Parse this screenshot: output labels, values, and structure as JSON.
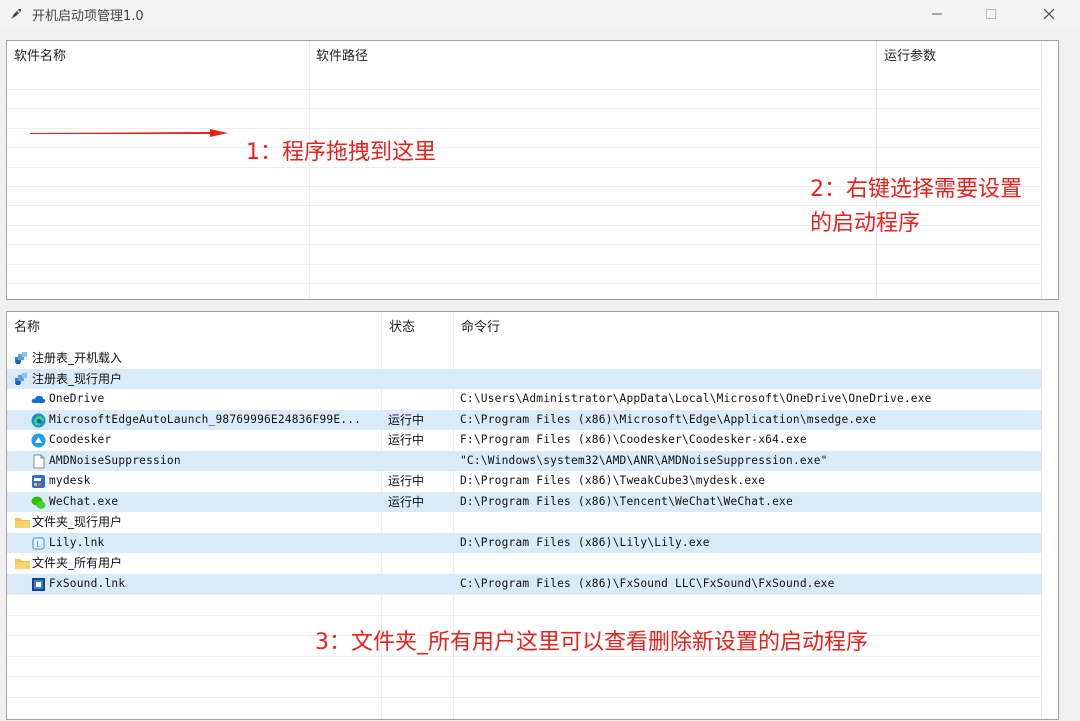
{
  "window": {
    "title": "开机启动项管理1.0"
  },
  "top_table": {
    "columns": [
      "软件名称",
      "软件路径",
      "运行参数"
    ]
  },
  "bottom_table": {
    "columns": [
      "名称",
      "状态",
      "命令行"
    ],
    "rows": [
      {
        "name": "注册表_开机载入",
        "status": "",
        "cmd": "",
        "icon": "registry-icon",
        "indent": 0,
        "selected": false
      },
      {
        "name": "注册表_现行用户",
        "status": "",
        "cmd": "",
        "icon": "registry-icon",
        "indent": 0,
        "selected": true
      },
      {
        "name": "OneDrive",
        "status": "",
        "cmd": "C:\\Users\\Administrator\\AppData\\Local\\Microsoft\\OneDrive\\OneDrive.exe",
        "icon": "onedrive-icon",
        "indent": 1,
        "selected": false
      },
      {
        "name": "MicrosoftEdgeAutoLaunch_98769996E24836F99E...",
        "status": "运行中",
        "cmd": "C:\\Program Files (x86)\\Microsoft\\Edge\\Application\\msedge.exe",
        "icon": "edge-icon",
        "indent": 1,
        "selected": true
      },
      {
        "name": "Coodesker",
        "status": "运行中",
        "cmd": "F:\\Program Files (x86)\\Coodesker\\Coodesker-x64.exe",
        "icon": "coodesker-icon",
        "indent": 1,
        "selected": false
      },
      {
        "name": "AMDNoiseSuppression",
        "status": "",
        "cmd": "\"C:\\Windows\\system32\\AMD\\ANR\\AMDNoiseSuppression.exe\"",
        "icon": "file-icon",
        "indent": 1,
        "selected": true
      },
      {
        "name": "mydesk",
        "status": "运行中",
        "cmd": "D:\\Program Files (x86)\\TweakCube3\\mydesk.exe",
        "icon": "mydesk-icon",
        "indent": 1,
        "selected": false
      },
      {
        "name": "WeChat.exe",
        "status": "运行中",
        "cmd": "D:\\Program Files (x86)\\Tencent\\WeChat\\WeChat.exe",
        "icon": "wechat-icon",
        "indent": 1,
        "selected": true
      },
      {
        "name": "文件夹_现行用户",
        "status": "",
        "cmd": "",
        "icon": "folder-icon",
        "indent": 0,
        "selected": false
      },
      {
        "name": "Lily.lnk",
        "status": "",
        "cmd": "D:\\Program Files (x86)\\Lily\\Lily.exe",
        "icon": "lily-icon",
        "indent": 1,
        "selected": true
      },
      {
        "name": "文件夹_所有用户",
        "status": "",
        "cmd": "",
        "icon": "folder-icon",
        "indent": 0,
        "selected": false
      },
      {
        "name": "FxSound.lnk",
        "status": "",
        "cmd": "C:\\Program Files (x86)\\FxSound LLC\\FxSound\\FxSound.exe",
        "icon": "fxsound-icon",
        "indent": 1,
        "selected": true
      }
    ]
  },
  "annotations": {
    "a1": "1：程序拖拽到这里",
    "a2_line1": "2：右键选择需要设置",
    "a2_line2": "的启动程序",
    "a3": "3：文件夹_所有用户这里可以查看删除新设置的启动程序"
  },
  "colors": {
    "annotation": "#e8211c",
    "selected_row": "#d9ebf9"
  }
}
